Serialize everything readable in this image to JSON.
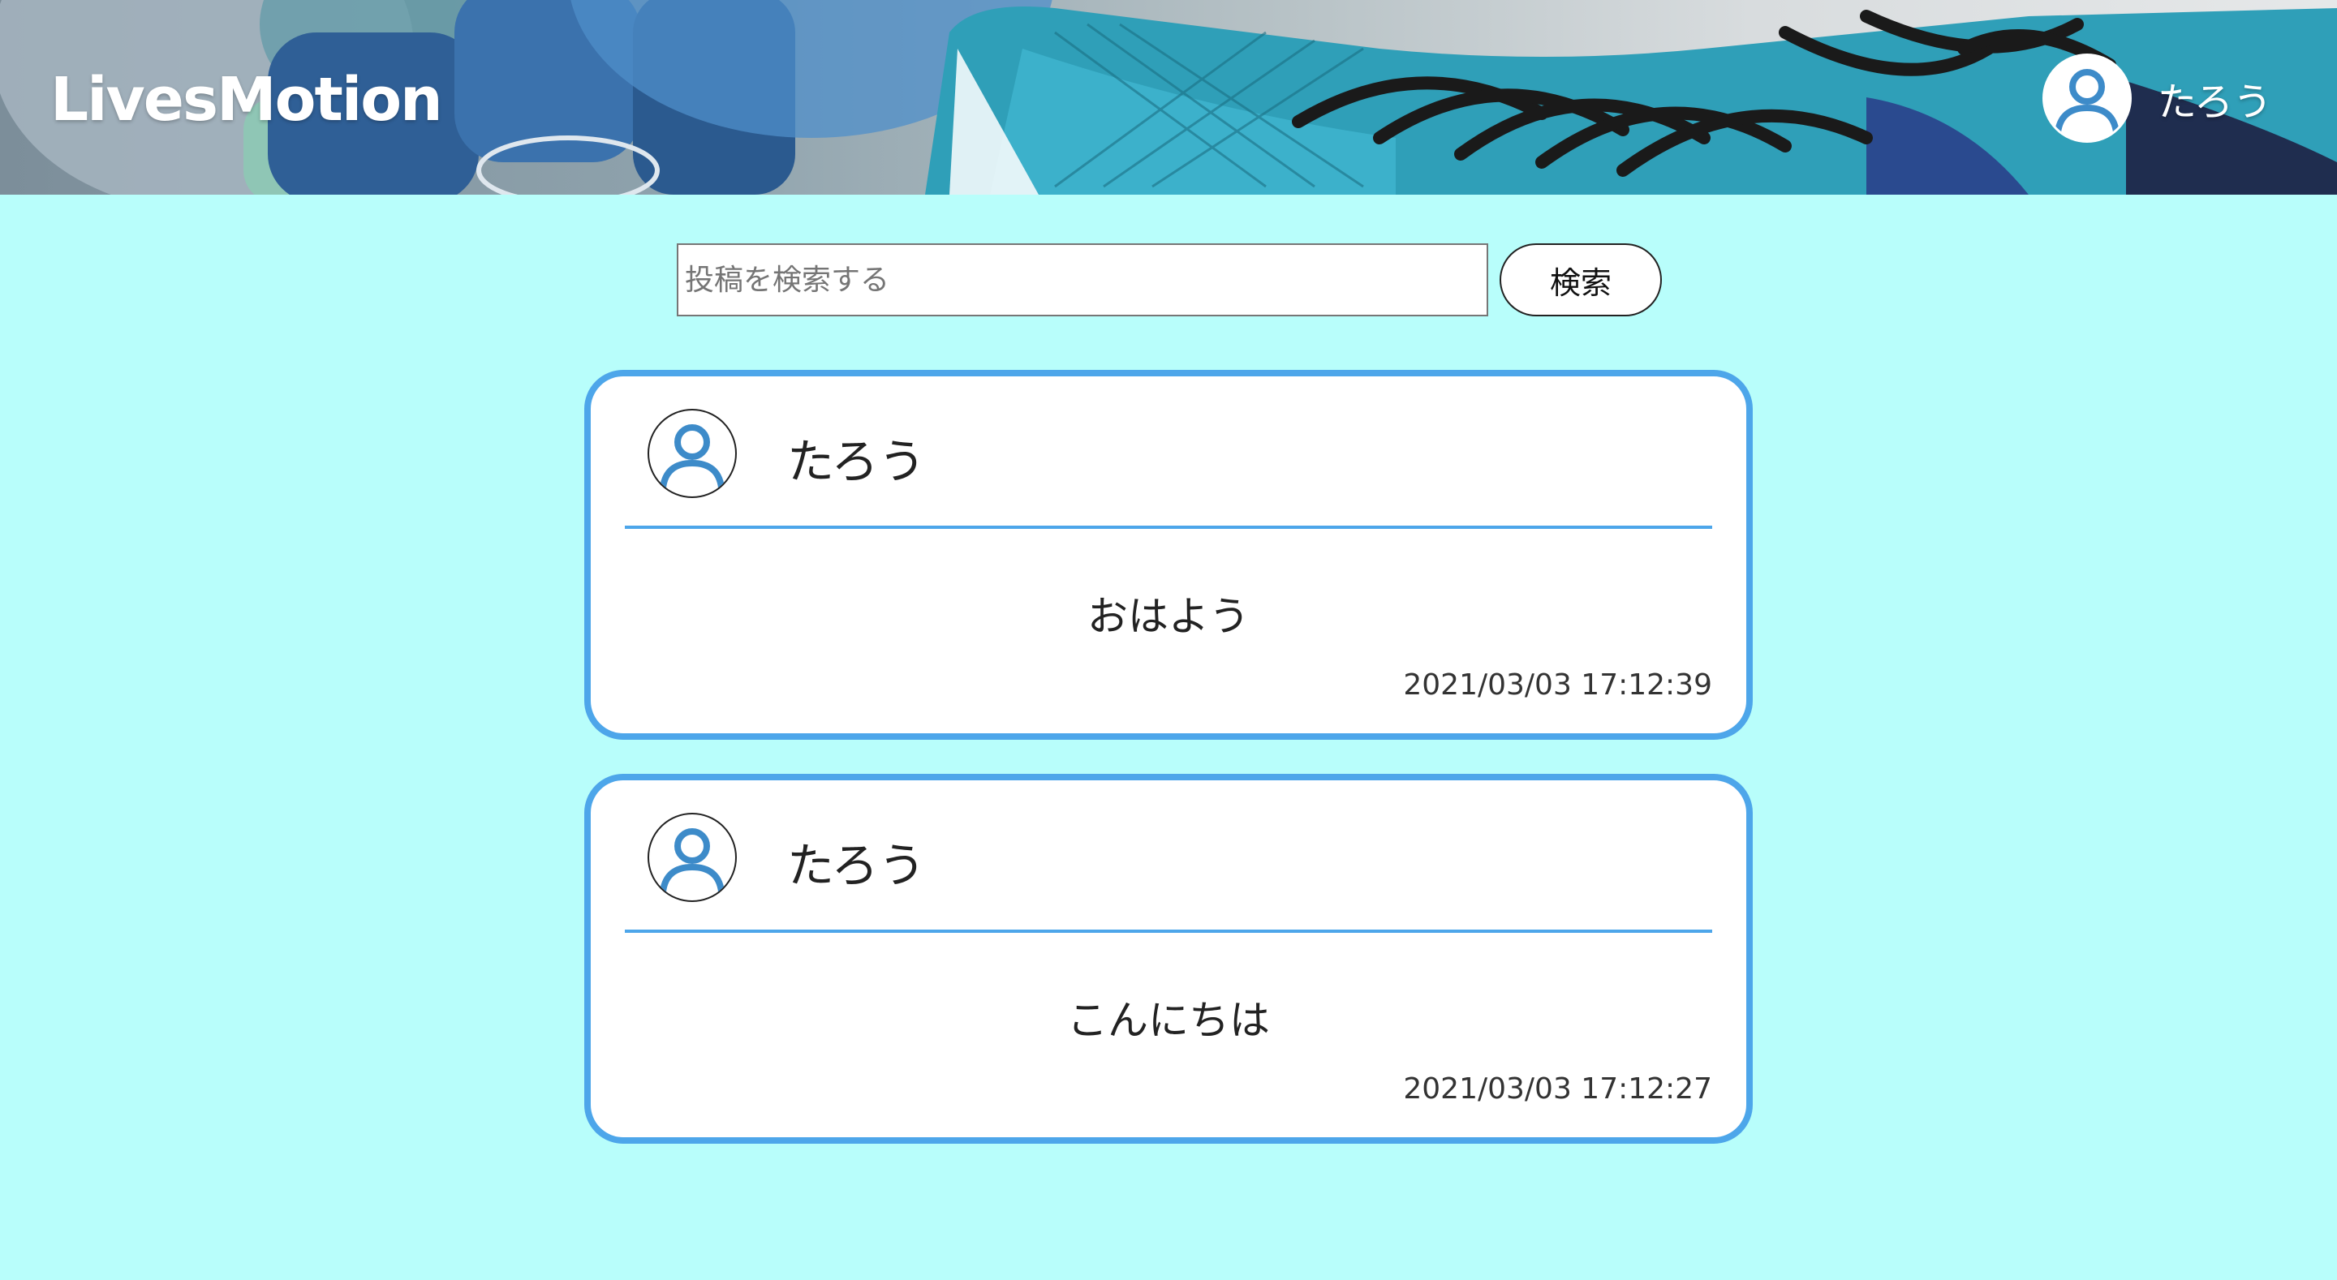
{
  "header": {
    "logo": "LivesMotion",
    "user_name": "たろう"
  },
  "search": {
    "placeholder": "投稿を検索する",
    "value": "",
    "button_label": "検索"
  },
  "posts": [
    {
      "author": "たろう",
      "content": "おはよう",
      "timestamp": "2021/03/03 17:12:39"
    },
    {
      "author": "たろう",
      "content": "こんにちは",
      "timestamp": "2021/03/03 17:12:27"
    }
  ],
  "colors": {
    "page_background": "#b8fefb",
    "card_border": "#4da6ea",
    "avatar_icon": "#3d8bc9"
  },
  "icons": {
    "header_avatar": "user-avatar-icon",
    "post_avatar": "user-avatar-icon"
  }
}
